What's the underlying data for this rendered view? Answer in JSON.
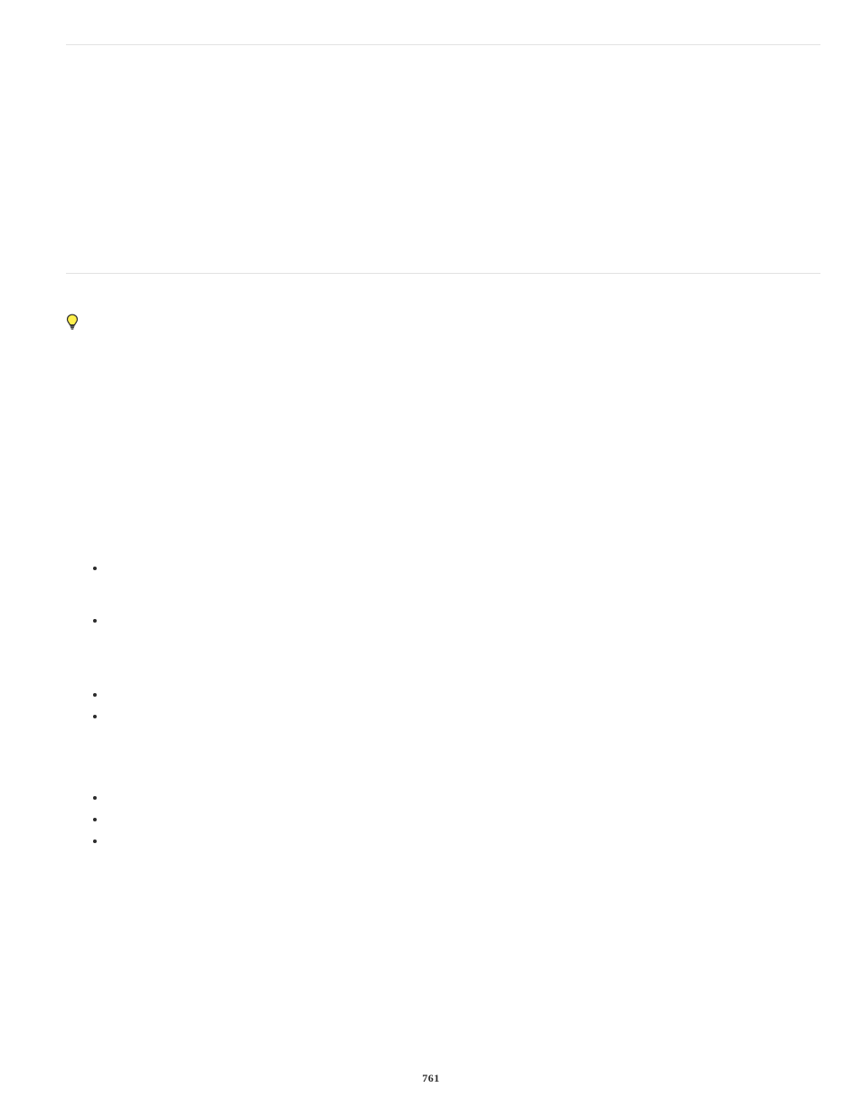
{
  "page_number": "761",
  "rules": {
    "top": true,
    "mid": true
  },
  "tip": {
    "icon": "lightbulb-icon"
  },
  "list_one": {
    "items": [
      "",
      "",
      "",
      ""
    ]
  },
  "list_two": {
    "items": [
      "",
      "",
      ""
    ]
  }
}
